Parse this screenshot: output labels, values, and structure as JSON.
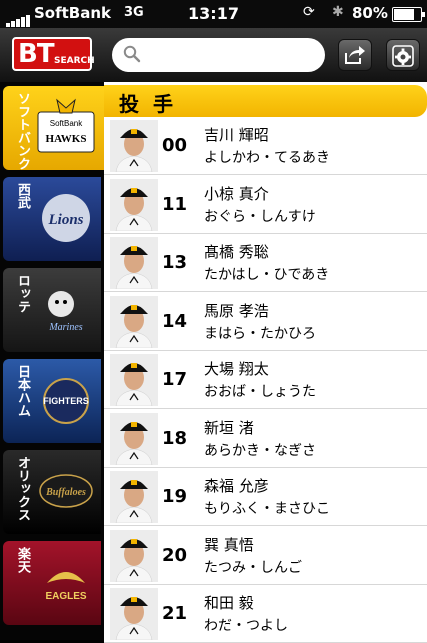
{
  "status_bar": {
    "carrier": "SoftBank",
    "network": "3G",
    "time": "13:17",
    "battery": "80%"
  },
  "toolbar": {
    "logo_main": "BT",
    "logo_sub": "SEARCH",
    "search_placeholder": "",
    "share_icon": "share-icon",
    "settings_icon": "gear-icon"
  },
  "sidebar": {
    "teams": [
      {
        "name": "ソフトバンク",
        "logo": "HAWKS",
        "logo_top": "SoftBank",
        "active": true,
        "color": "#f2b400"
      },
      {
        "name": "西武",
        "logo": "Lions",
        "active": false,
        "color": "#1b2f6b"
      },
      {
        "name": "ロッテ",
        "logo": "Marines",
        "active": false,
        "color": "#2b2b2b"
      },
      {
        "name": "日本ハム",
        "logo": "FIGHTERS",
        "active": false,
        "color": "#173a7a"
      },
      {
        "name": "オリックス",
        "logo": "Buffaloes",
        "active": false,
        "color": "#101010"
      },
      {
        "name": "楽天",
        "logo": "EAGLES",
        "active": false,
        "color": "#8a0f1e"
      }
    ]
  },
  "main": {
    "section_title": "投手",
    "players": [
      {
        "number": "00",
        "name": "吉川 輝昭",
        "kana": "よしかわ・てるあき"
      },
      {
        "number": "11",
        "name": "小椋 真介",
        "kana": "おぐら・しんすけ"
      },
      {
        "number": "13",
        "name": "髙橋 秀聡",
        "kana": "たかはし・ひであき"
      },
      {
        "number": "14",
        "name": "馬原 孝浩",
        "kana": "まはら・たかひろ"
      },
      {
        "number": "17",
        "name": "大場 翔太",
        "kana": "おおば・しょうた"
      },
      {
        "number": "18",
        "name": "新垣 渚",
        "kana": "あらかき・なぎさ"
      },
      {
        "number": "19",
        "name": "森福 允彦",
        "kana": "もりふく・まさひこ"
      },
      {
        "number": "20",
        "name": "巽 真悟",
        "kana": "たつみ・しんご"
      },
      {
        "number": "21",
        "name": "和田 毅",
        "kana": "わだ・つよし"
      }
    ]
  },
  "colors": {
    "header_yellow": "#f2b400",
    "logo_red": "#d21010"
  }
}
